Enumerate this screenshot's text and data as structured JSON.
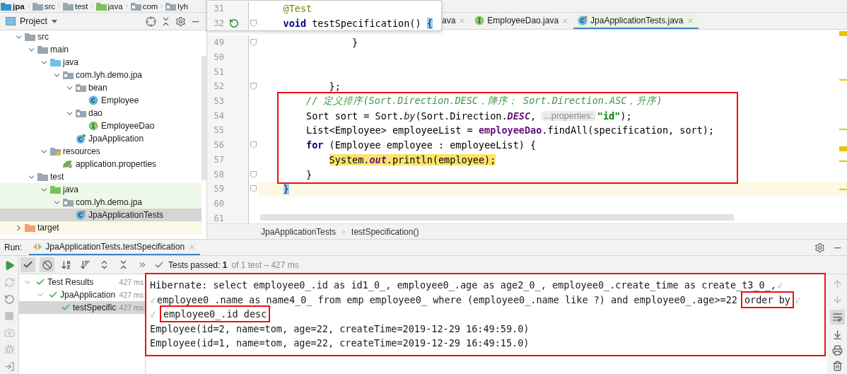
{
  "navigation_bar": {
    "items": [
      {
        "label": "jpa",
        "kind": "module"
      },
      {
        "label": "src",
        "kind": "folder"
      },
      {
        "label": "test",
        "kind": "folder"
      },
      {
        "label": "java",
        "kind": "test-folder"
      },
      {
        "label": "com",
        "kind": "package"
      },
      {
        "label": "lyh",
        "kind": "package"
      }
    ]
  },
  "project_panel": {
    "title": "Project",
    "tree": [
      {
        "label": "src",
        "kind": "folder",
        "expanded": true,
        "selected": false,
        "children": [
          {
            "label": "main",
            "kind": "folder",
            "expanded": true,
            "selected": false,
            "children": [
              {
                "label": "java",
                "kind": "source-folder",
                "expanded": true,
                "selected": false,
                "children": [
                  {
                    "label": "com.lyh.demo.jpa",
                    "kind": "package",
                    "expanded": true,
                    "selected": false,
                    "children": [
                      {
                        "label": "bean",
                        "kind": "package",
                        "expanded": true,
                        "selected": false,
                        "children": [
                          {
                            "label": "Employee",
                            "kind": "class",
                            "selected": false
                          }
                        ]
                      },
                      {
                        "label": "dao",
                        "kind": "package",
                        "expanded": true,
                        "selected": false,
                        "children": [
                          {
                            "label": "EmployeeDao",
                            "kind": "interface",
                            "selected": false
                          }
                        ]
                      },
                      {
                        "label": "JpaApplication",
                        "kind": "spring-class",
                        "selected": false
                      }
                    ]
                  }
                ]
              },
              {
                "label": "resources",
                "kind": "resources-folder",
                "expanded": true,
                "selected": false,
                "children": [
                  {
                    "label": "application.properties",
                    "kind": "spring-properties",
                    "selected": false
                  }
                ]
              }
            ]
          },
          {
            "label": "test",
            "kind": "folder",
            "expanded": true,
            "selected": false,
            "children": [
              {
                "label": "java",
                "kind": "test-folder",
                "test_source": true,
                "expanded": true,
                "selected": false,
                "children": [
                  {
                    "label": "com.lyh.demo.jpa",
                    "kind": "package",
                    "test_source": true,
                    "expanded": true,
                    "selected": false,
                    "children": [
                      {
                        "label": "JpaApplicationTests",
                        "kind": "test-class",
                        "test_source": true,
                        "selected": true
                      }
                    ]
                  }
                ]
              }
            ]
          }
        ]
      },
      {
        "label": "target",
        "kind": "excluded-folder",
        "excluded": true,
        "expanded": false,
        "selected": false
      }
    ]
  },
  "editor": {
    "tabs": [
      {
        "label": "ava",
        "kind": "plain",
        "selected": false
      },
      {
        "label": "EmployeeDao.java",
        "kind": "interface",
        "selected": false
      },
      {
        "label": "JpaApplicationTests.java",
        "kind": "test-class",
        "selected": true
      }
    ],
    "sticky_lines": [
      {
        "number": "31",
        "tokens": [
          {
            "kind": "annotation",
            "text": "@Test"
          }
        ]
      },
      {
        "number": "32",
        "fold": true,
        "runnable": true,
        "tokens": [
          {
            "kind": "keyword",
            "text": "void"
          },
          {
            "kind": "plain",
            "text": " testSpecification() "
          },
          {
            "kind": "brace",
            "text": "{"
          }
        ]
      }
    ],
    "lines": [
      {
        "number": "49",
        "fold": true,
        "tokens": [
          {
            "kind": "plain",
            "text": "}"
          }
        ]
      },
      {
        "number": "50"
      },
      {
        "number": "51"
      },
      {
        "number": "52",
        "fold": true,
        "tokens": [
          {
            "kind": "plain",
            "text": "};"
          }
        ]
      },
      {
        "number": "53",
        "tokens": [
          {
            "kind": "comment",
            "text": "// 定义排序(Sort.Direction.DESC，降序； Sort.Direction.ASC，升序)"
          }
        ]
      },
      {
        "number": "54",
        "tokens": [
          {
            "kind": "plain",
            "text": "Sort sort = Sort."
          },
          {
            "kind": "static",
            "text": "by"
          },
          {
            "kind": "plain",
            "text": "(Sort.Direction."
          },
          {
            "kind": "constant",
            "text": "DESC"
          },
          {
            "kind": "plain",
            "text": ", "
          },
          {
            "kind": "hint",
            "text": "...properties:"
          },
          {
            "kind": "string",
            "text": "\"id\""
          },
          {
            "kind": "plain",
            "text": ");"
          }
        ]
      },
      {
        "number": "55",
        "tokens": [
          {
            "kind": "plain",
            "text": "List<Employee> employeeList = "
          },
          {
            "kind": "field",
            "text": "employeeDao"
          },
          {
            "kind": "plain",
            "text": ".findAll(specification, sort);"
          }
        ]
      },
      {
        "number": "56",
        "fold": true,
        "tokens": [
          {
            "kind": "keyword",
            "text": "for"
          },
          {
            "kind": "plain",
            "text": " (Employee employee : employeeList) {"
          }
        ]
      },
      {
        "number": "57",
        "tokens": [
          {
            "kind": "plain",
            "text": "System.",
            "marked": true
          },
          {
            "kind": "constant",
            "text": "out",
            "marked": true
          },
          {
            "kind": "plain",
            "text": ".println(employee);",
            "marked": true
          }
        ]
      },
      {
        "number": "58",
        "fold": true,
        "tokens": [
          {
            "kind": "plain",
            "text": "}"
          }
        ]
      },
      {
        "number": "59",
        "fold": true,
        "current": true,
        "tokens": [
          {
            "kind": "brace",
            "text": "}"
          }
        ]
      },
      {
        "number": "60"
      },
      {
        "number": "61"
      }
    ],
    "breadcrumbs": [
      "JpaApplicationTests",
      "testSpecification()"
    ]
  },
  "run_panel": {
    "label": "Run:",
    "tabs": [
      {
        "label": "JpaApplicationTests.testSpecification",
        "selected": true
      }
    ],
    "status": {
      "passed": "Tests passed: **1**",
      "detail": "of 1 test – 427 ms"
    },
    "test_tree": [
      {
        "label": "Test Results",
        "time": "427 ms",
        "passed": true,
        "expanded": true,
        "selected": false,
        "children": [
          {
            "label": "JpaApplication",
            "time": "427 ms",
            "passed": true,
            "expanded": true,
            "selected": false,
            "children": [
              {
                "label": "testSpecific",
                "time": "427 ms",
                "passed": true,
                "selected": true
              }
            ]
          }
        ]
      }
    ],
    "console": [
      {
        "text": "Hibernate: select employee0_.id as id1_0_, employee0_.age as age2_0_, employee0_.create_time as create_t3_0_,",
        "wrap_end": true
      },
      {
        "text": "employee0_.name as name4_0_ from emp employee0_ where (employee0_.name like ?) and employee0_.age>=22",
        "boxed_text": "order by",
        "wrap_start": true,
        "wrap_end": true
      },
      {
        "boxed_text": "employee0_.id desc",
        "wrap_start": true
      },
      {
        "text": "Employee(id=2, name=tom, age=22, createTime=2019-12-29 16:49:59.0)"
      },
      {
        "text": "Employee(id=1, name=tom, age=22, createTime=2019-12-29 16:49:15.0)"
      }
    ]
  }
}
